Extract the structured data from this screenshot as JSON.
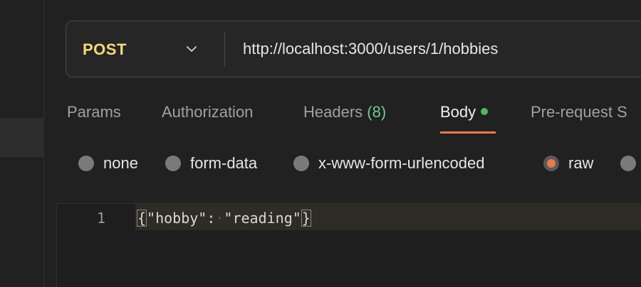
{
  "request": {
    "method": "POST",
    "url": "http://localhost:3000/users/1/hobbies"
  },
  "tabs": {
    "params": "Params",
    "authorization": "Authorization",
    "headers": "Headers",
    "headers_count": "(8)",
    "body": "Body",
    "prerequest": "Pre-request S"
  },
  "body_types": {
    "none": "none",
    "form_data": "form-data",
    "urlencoded": "x-www-form-urlencoded",
    "raw": "raw",
    "selected": "raw"
  },
  "editor": {
    "line_number": "1",
    "open_brace": "{",
    "key": "\"hobby\":",
    "whitespace_marker": "·",
    "value": "\"reading\"",
    "close_brace": "}"
  },
  "colors": {
    "accent": "#ee7a45",
    "method": "#f6d97a",
    "status_dot": "#4cbb5f",
    "count": "#6ec98a"
  }
}
